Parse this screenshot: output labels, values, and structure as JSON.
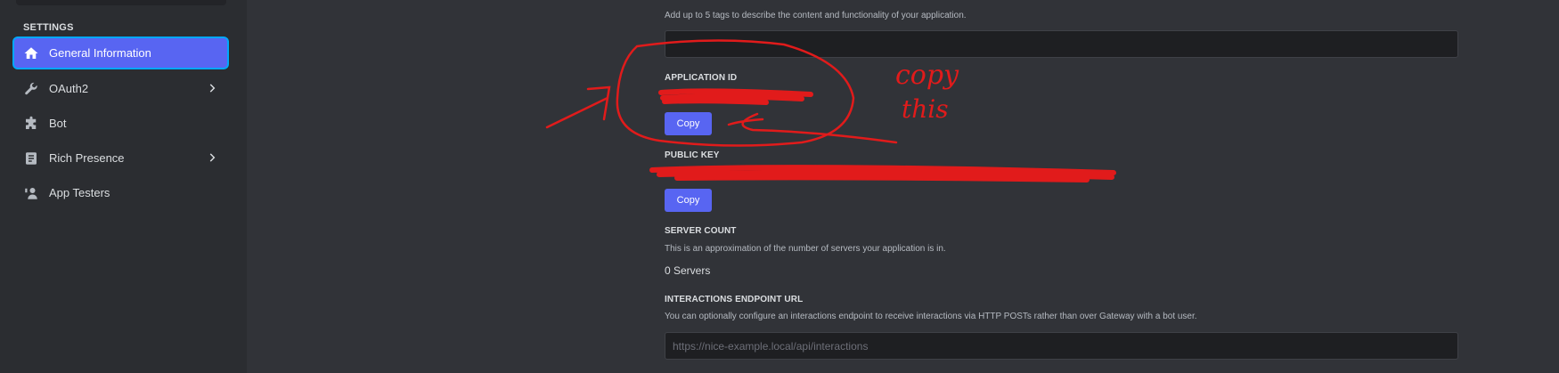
{
  "sidebar": {
    "section_label": "SETTINGS",
    "items": [
      {
        "label": "General Information",
        "icon": "home-icon",
        "active": true,
        "chevron": false
      },
      {
        "label": "OAuth2",
        "icon": "wrench-icon",
        "active": false,
        "chevron": true
      },
      {
        "label": "Bot",
        "icon": "puzzle-icon",
        "active": false,
        "chevron": false
      },
      {
        "label": "Rich Presence",
        "icon": "document-icon",
        "active": false,
        "chevron": true
      },
      {
        "label": "App Testers",
        "icon": "person-phone-icon",
        "active": false,
        "chevron": false
      }
    ]
  },
  "main": {
    "tags": {
      "description": "Add up to 5 tags to describe the content and functionality of your application.",
      "value": ""
    },
    "application_id": {
      "label": "APPLICATION ID",
      "copy_label": "Copy"
    },
    "public_key": {
      "label": "PUBLIC KEY",
      "copy_label": "Copy"
    },
    "server_count": {
      "label": "SERVER COUNT",
      "description": "This is an approximation of the number of servers your application is in.",
      "value": "0 Servers"
    },
    "interactions": {
      "label": "INTERACTIONS ENDPOINT URL",
      "description": "You can optionally configure an interactions endpoint to receive interactions via HTTP POSTs rather than over Gateway with a bot user.",
      "placeholder": "https://nice-example.local/api/interactions"
    }
  },
  "annotation": {
    "line1": "copy",
    "line2": "this"
  },
  "colors": {
    "accent": "#5865f2",
    "focus": "#00a8fc",
    "annotation": "#e11b1b"
  }
}
